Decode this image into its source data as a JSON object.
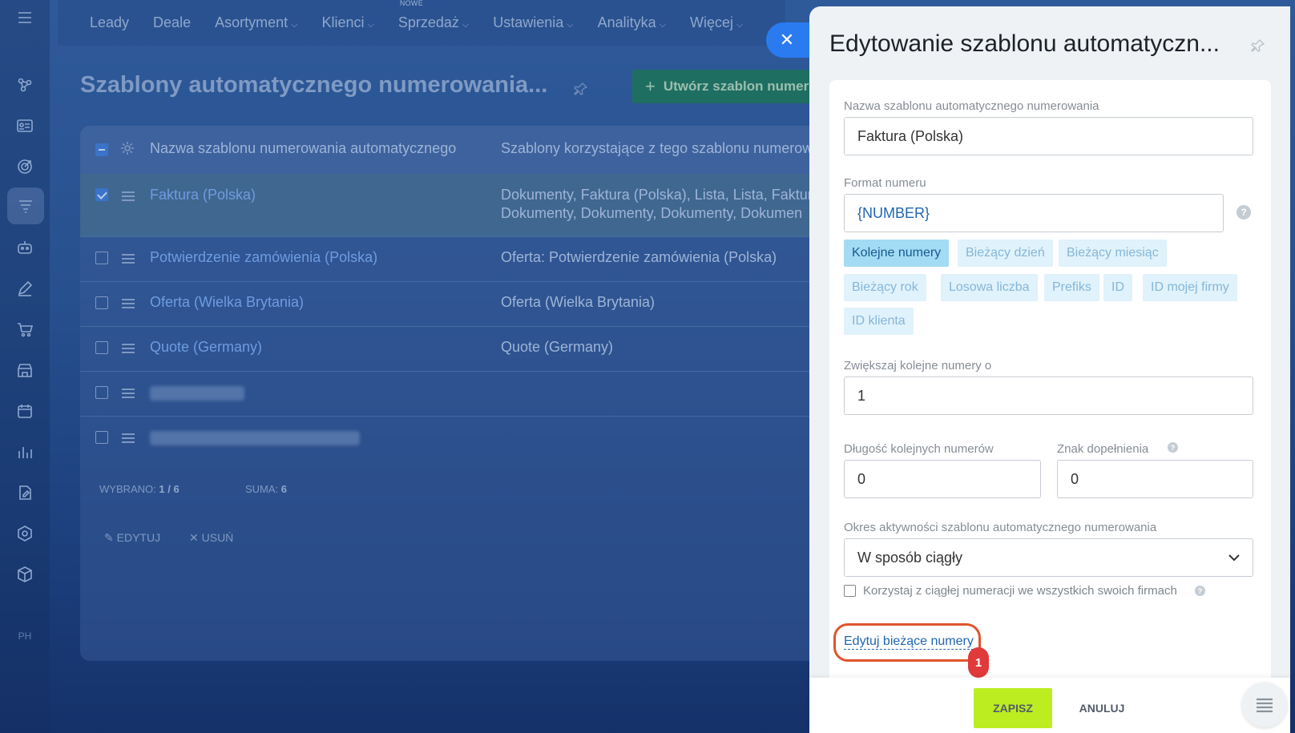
{
  "topnav": {
    "items": [
      {
        "label": "Leady",
        "chevron": false
      },
      {
        "label": "Deale",
        "chevron": false
      },
      {
        "label": "Asortyment",
        "chevron": true
      },
      {
        "label": "Klienci",
        "chevron": true
      },
      {
        "label": "Sprzedaż",
        "chevron": true,
        "badge": "NOWE"
      },
      {
        "label": "Ustawienia",
        "chevron": true
      },
      {
        "label": "Analityka",
        "chevron": true
      },
      {
        "label": "Więcej",
        "chevron": true
      }
    ]
  },
  "rail": {
    "bottom_label": "PH"
  },
  "page": {
    "title": "Szablony automatycznego numerowania...",
    "create_button": "Utwórz szablon numer"
  },
  "grid": {
    "columns": [
      "Nazwa szablonu numerowania automatycznego",
      "Szablony korzystające z tego szablonu numerow"
    ],
    "rows": [
      {
        "name": "Faktura (Polska)",
        "templates_line1": "Dokumenty, Faktura (Polska), Lista, Lista, Faktura",
        "templates_line2": "Dokumenty, Dokumenty, Dokumenty, Dokumen",
        "checked": true
      },
      {
        "name": "Potwierdzenie zamówienia (Polska)",
        "templates_line1": "Oferta: Potwierdzenie zamówienia (Polska)",
        "checked": false
      },
      {
        "name": "Oferta (Wielka Brytania)",
        "templates_line1": "Oferta (Wielka Brytania)",
        "checked": false
      },
      {
        "name": "Quote (Germany)",
        "templates_line1": "Quote (Germany)",
        "checked": false
      }
    ],
    "footer": {
      "selected_label": "WYBRANO:",
      "selected_value": "1 / 6",
      "total_label": "SUMA:",
      "total_value": "6"
    },
    "actions": {
      "edit": "EDYTUJ",
      "delete": "USUŃ"
    }
  },
  "panel": {
    "title": "Edytowanie szablonu automatyczn...",
    "name_label": "Nazwa szablonu automatycznego numerowania",
    "name_value": "Faktura (Polska)",
    "format_label": "Format numeru",
    "format_value": "{NUMBER}",
    "tags": [
      "Kolejne numery",
      "Bieżący dzień",
      "Bieżący miesiąc",
      "Bieżący rok",
      "Losowa liczba",
      "Prefiks",
      "ID",
      "ID mojej firmy",
      "ID klienta"
    ],
    "increment_label": "Zwiększaj kolejne numery o",
    "increment_value": "1",
    "length_label": "Długość kolejnych numerów",
    "length_value": "0",
    "pad_label": "Znak dopełnienia",
    "pad_value": "0",
    "period_label": "Okres aktywności szablonu automatycznego numerowania",
    "period_value": "W sposób ciągły",
    "continuous_label": "Korzystaj z ciągłej numeracji we wszystkich swoich firmach",
    "edit_link": "Edytuj bieżące numery",
    "step_badge": "1",
    "save": "ZAPISZ",
    "cancel": "ANULUJ",
    "help_glyph": "?"
  },
  "colors": {
    "accent": "#2a7bf0",
    "save": "#bbed21",
    "highlight": "#e0552c",
    "badge": "#e03a3a"
  }
}
